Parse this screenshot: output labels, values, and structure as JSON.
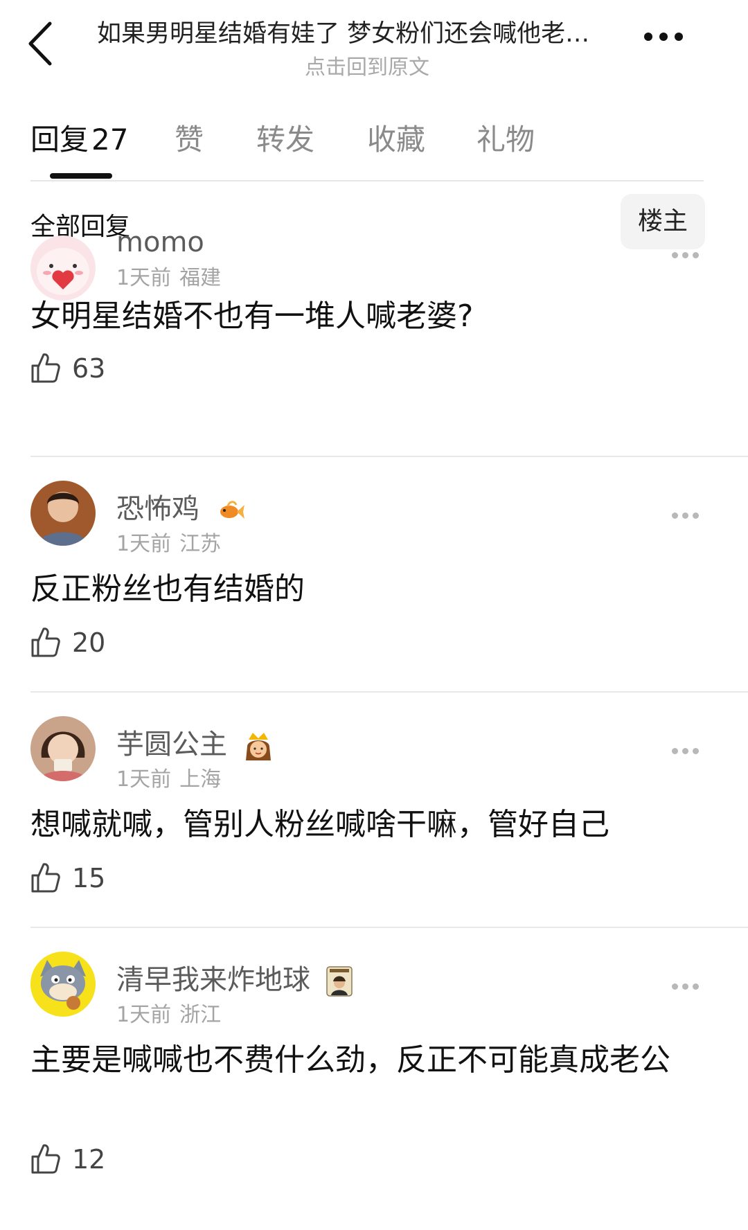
{
  "header": {
    "title": "如果男明星结婚有娃了 梦女粉们还会喊他老…",
    "subtitle": "点击回到原文"
  },
  "tabs": [
    {
      "label": "回复",
      "count": "27",
      "active": true
    },
    {
      "label": "赞"
    },
    {
      "label": "转发"
    },
    {
      "label": "收藏"
    },
    {
      "label": "礼物"
    }
  ],
  "filter": {
    "all_replies_label": "全部回复",
    "op_only_label": "楼主"
  },
  "comments": [
    {
      "username": "momo",
      "time": "1天前",
      "location": "福建",
      "text": "女明星结婚不也有一堆人喊老婆?",
      "likes": "63",
      "avatar_icon": "pink-heart-avatar"
    },
    {
      "username": "恐怖鸡",
      "time": "1天前",
      "location": "江苏",
      "text": "反正粉丝也有结婚的",
      "likes": "20",
      "avatar_icon": "person-avatar",
      "badge_icon": "goldfish-icon"
    },
    {
      "username": "芋圆公主",
      "time": "1天前",
      "location": "上海",
      "text": "想喊就喊，管别人粉丝喊啥干嘛，管好自己",
      "likes": "15",
      "avatar_icon": "girl-avatar",
      "badge_icon": "princess-emoji-icon"
    },
    {
      "username": "清早我来炸地球",
      "time": "1天前",
      "location": "浙江",
      "text": "主要是喊喊也不费什么劲，反正不可能真成老公",
      "likes": "12",
      "avatar_icon": "cartoon-cat-avatar",
      "badge_icon": "poster-badge-icon"
    }
  ]
}
